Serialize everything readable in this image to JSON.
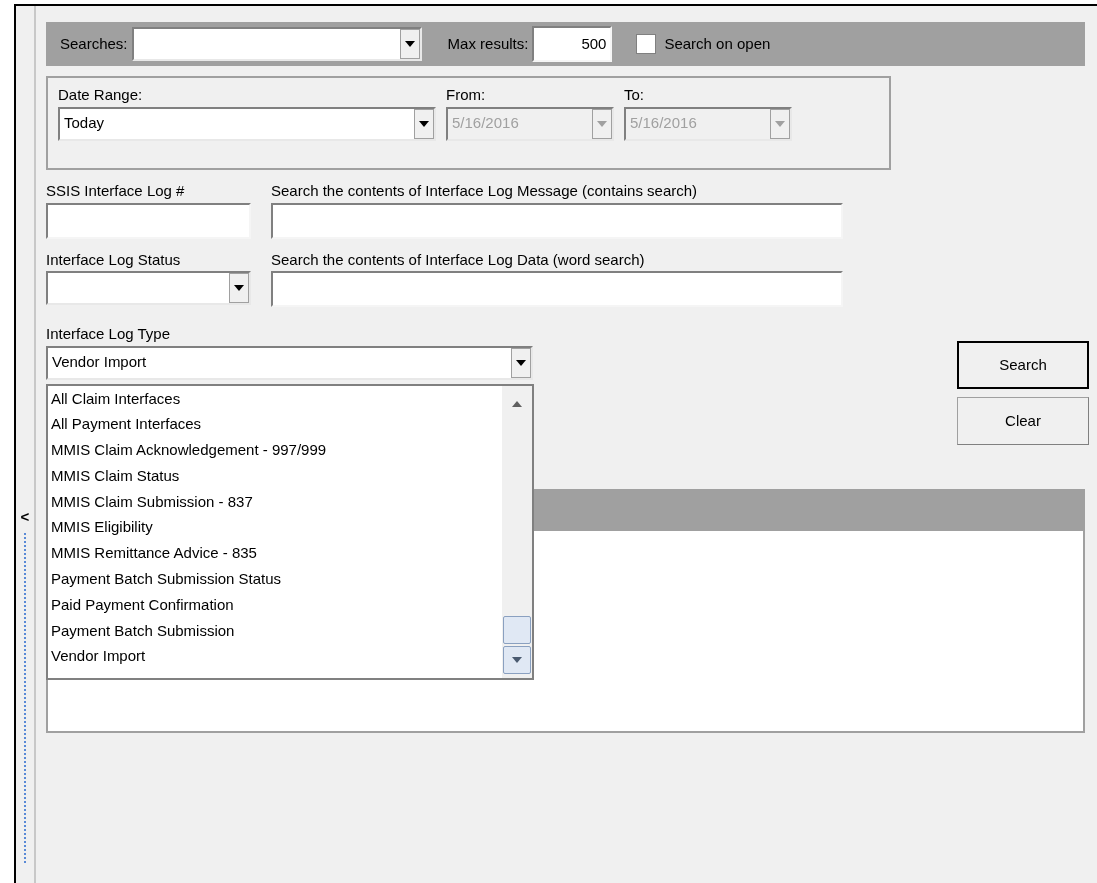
{
  "toolbar": {
    "searches_label": "Searches:",
    "max_results_label": "Max results:",
    "max_results_value": "500",
    "search_on_open": {
      "label": "Search on open",
      "checked": false
    }
  },
  "date_range": {
    "label": "Date Range:",
    "value": "Today",
    "from_label": "From:",
    "from_value": "5/16/2016",
    "from_disabled": true,
    "to_label": "To:",
    "to_value": "5/16/2016",
    "to_disabled": true
  },
  "fields": {
    "log_number_label": "SSIS Interface Log #",
    "message_label": "Search the contents of Interface Log Message (contains search)",
    "status_label": "Interface Log Status",
    "data_label": "Search the contents of Interface Log Data (word search)",
    "type_label": "Interface Log Type",
    "type_value": "Vendor Import"
  },
  "type_options": [
    {
      "label": "All Claim Interfaces"
    },
    {
      "label": "All Payment Interfaces"
    },
    {
      "label": "MMIS Claim Acknowledgement - 997/999"
    },
    {
      "label": "MMIS Claim Status"
    },
    {
      "label": "MMIS Claim Submission - 837"
    },
    {
      "label": "MMIS Eligibility"
    },
    {
      "label": "MMIS Remittance Advice - 835"
    },
    {
      "label": "Payment Batch Submission Status"
    },
    {
      "label": "Paid Payment Confirmation"
    },
    {
      "label": "Payment Batch Submission"
    },
    {
      "label": "Vendor Import"
    }
  ],
  "buttons": [
    {
      "label": "Search",
      "default": true
    },
    {
      "label": "Clear",
      "default": false
    }
  ],
  "side_toggle": "<"
}
